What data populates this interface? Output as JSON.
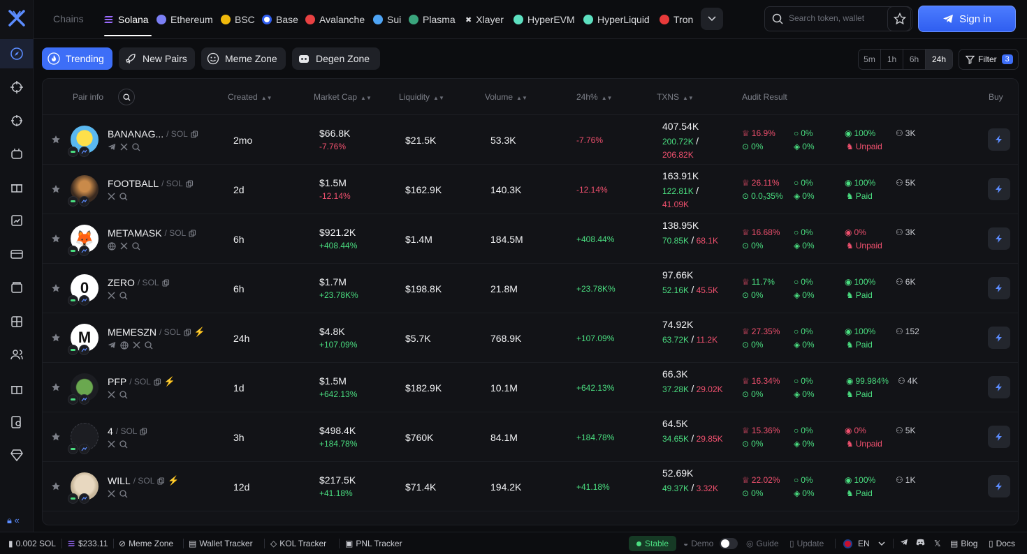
{
  "topbar": {
    "chains_label": "Chains",
    "chains": [
      {
        "label": "Solana",
        "color": "#9b6bff"
      },
      {
        "label": "Ethereum",
        "color": "#7b7ff5"
      },
      {
        "label": "BSC",
        "color": "#f0b90b"
      },
      {
        "label": "Base",
        "color": "#2f5ef0"
      },
      {
        "label": "Avalanche",
        "color": "#e84142"
      },
      {
        "label": "Sui",
        "color": "#4ea4f5"
      },
      {
        "label": "Plasma",
        "color": "#3aa57d"
      },
      {
        "label": "Xlayer",
        "color": "#ffffff"
      },
      {
        "label": "HyperEVM",
        "color": "#5de0c0"
      },
      {
        "label": "HyperLiquid",
        "color": "#5de0c0"
      },
      {
        "label": "Tron",
        "color": "#e83a3a"
      }
    ],
    "search_placeholder": "Search token, wallet",
    "sign_in": "Sign in"
  },
  "zones": [
    "Trending",
    "New Pairs",
    "Meme Zone",
    "Degen Zone"
  ],
  "timeframes": [
    "5m",
    "1h",
    "6h",
    "24h"
  ],
  "active_timeframe": "24h",
  "filter": {
    "label": "Filter",
    "count": "3"
  },
  "table": {
    "headers": {
      "pair_info": "Pair info",
      "created": "Created",
      "market_cap": "Market Cap",
      "liquidity": "Liquidity",
      "volume": "Volume",
      "change": "24h%",
      "txns": "TXNS",
      "audit": "Audit Result",
      "buy": "Buy"
    },
    "rows": [
      {
        "name": "BANANAG...",
        "chain": "/ SOL",
        "created": "2mo",
        "mcap": "$66.8K",
        "mcap_chg": "-7.76%",
        "liq": "$21.5K",
        "vol": "53.3K",
        "chg": "-7.76%",
        "tx": "407.54K",
        "buys": "200.72K",
        "sells": "206.82K",
        "a1": "16.9%",
        "a2": "0%",
        "a3": "0%",
        "a4": "0%",
        "a5": "100%",
        "a6": "Unpaid",
        "holders": "3K"
      },
      {
        "name": "FOOTBALL",
        "chain": "/ SOL",
        "created": "2d",
        "mcap": "$1.5M",
        "mcap_chg": "-12.14%",
        "liq": "$162.9K",
        "vol": "140.3K",
        "chg": "-12.14%",
        "tx": "163.91K",
        "buys": "122.81K",
        "sells": "41.09K",
        "a1": "26.11%",
        "a2": "0.0₃35%",
        "a3": "0%",
        "a4": "0%",
        "a5": "100%",
        "a6": "Paid",
        "holders": "5K"
      },
      {
        "name": "METAMASK",
        "chain": "/ SOL",
        "created": "6h",
        "mcap": "$921.2K",
        "mcap_chg": "+408.44%",
        "liq": "$1.4M",
        "vol": "184.5M",
        "chg": "+408.44%",
        "tx": "138.95K",
        "buys": "70.85K",
        "sells": "68.1K",
        "a1": "16.68%",
        "a2": "0%",
        "a3": "0%",
        "a4": "0%",
        "a5": "0%",
        "a6": "Unpaid",
        "holders": "3K"
      },
      {
        "name": "ZERO",
        "chain": "/ SOL",
        "created": "6h",
        "mcap": "$1.7M",
        "mcap_chg": "+23.78K%",
        "liq": "$198.8K",
        "vol": "21.8M",
        "chg": "+23.78K%",
        "tx": "97.66K",
        "buys": "52.16K",
        "sells": "45.5K",
        "a1": "11.7%",
        "a2": "0%",
        "a3": "0%",
        "a4": "0%",
        "a5": "100%",
        "a6": "Paid",
        "holders": "6K"
      },
      {
        "name": "MEMESZN",
        "chain": "/ SOL",
        "created": "24h",
        "mcap": "$4.8K",
        "mcap_chg": "+107.09%",
        "liq": "$5.7K",
        "vol": "768.9K",
        "chg": "+107.09%",
        "tx": "74.92K",
        "buys": "63.72K",
        "sells": "11.2K",
        "a1": "27.35%",
        "a2": "0%",
        "a3": "0%",
        "a4": "0%",
        "a5": "100%",
        "a6": "Paid",
        "holders": "152"
      },
      {
        "name": "PFP",
        "chain": "/ SOL",
        "created": "1d",
        "mcap": "$1.5M",
        "mcap_chg": "+642.13%",
        "liq": "$182.9K",
        "vol": "10.1M",
        "chg": "+642.13%",
        "tx": "66.3K",
        "buys": "37.28K",
        "sells": "29.02K",
        "a1": "16.34%",
        "a2": "0%",
        "a3": "0%",
        "a4": "0%",
        "a5": "99.984%",
        "a6": "Paid",
        "holders": "4K"
      },
      {
        "name": "4",
        "chain": "/ SOL",
        "created": "3h",
        "mcap": "$498.4K",
        "mcap_chg": "+184.78%",
        "liq": "$760K",
        "vol": "84.1M",
        "chg": "+184.78%",
        "tx": "64.5K",
        "buys": "34.65K",
        "sells": "29.85K",
        "a1": "15.36%",
        "a2": "0%",
        "a3": "0%",
        "a4": "0%",
        "a5": "0%",
        "a6": "Unpaid",
        "holders": "5K"
      },
      {
        "name": "WILL",
        "chain": "/ SOL",
        "created": "12d",
        "mcap": "$217.5K",
        "mcap_chg": "+41.18%",
        "liq": "$71.4K",
        "vol": "194.2K",
        "chg": "+41.18%",
        "tx": "52.69K",
        "buys": "49.37K",
        "sells": "3.32K",
        "a1": "22.02%",
        "a2": "0%",
        "a3": "0%",
        "a4": "0%",
        "a5": "100%",
        "a6": "Paid",
        "holders": "1K"
      }
    ]
  },
  "bottombar": {
    "sol_balance": "0.002 SOL",
    "sol_price": "$233.11",
    "meme_zone": "Meme Zone",
    "wallet_tracker": "Wallet Tracker",
    "kol_tracker": "KOL Tracker",
    "pnl_tracker": "PNL Tracker",
    "stable": "Stable",
    "demo": "Demo",
    "guide": "Guide",
    "update": "Update",
    "lang": "EN",
    "blog": "Blog",
    "docs": "Docs"
  },
  "colors": {
    "accent": "#3d6ef7",
    "positive": "#4ade80",
    "negative": "#f0506e"
  }
}
